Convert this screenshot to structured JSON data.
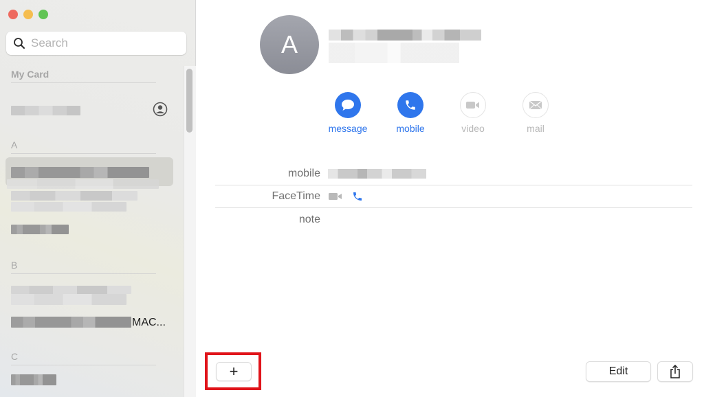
{
  "window": {
    "traffic_lights": [
      "close",
      "minimize",
      "maximize"
    ]
  },
  "sidebar": {
    "search": {
      "placeholder": "Search",
      "value": "",
      "icon": "search-icon"
    },
    "my_card_header": "My Card",
    "my_card_icon": "person-circle-icon",
    "sections": [
      {
        "letter": "A"
      },
      {
        "letter": "B"
      },
      {
        "letter": "C"
      }
    ],
    "visible_truncated_text": "MAC..."
  },
  "contact": {
    "avatar_initial": "A",
    "actions": [
      {
        "label": "message",
        "icon": "message-bubble-icon",
        "enabled": true
      },
      {
        "label": "mobile",
        "icon": "phone-icon",
        "enabled": true
      },
      {
        "label": "video",
        "icon": "video-camera-icon",
        "enabled": false
      },
      {
        "label": "mail",
        "icon": "envelope-icon",
        "enabled": false
      }
    ],
    "fields": [
      {
        "label": "mobile"
      },
      {
        "label": "FaceTime"
      },
      {
        "label": "note"
      }
    ]
  },
  "toolbar": {
    "add_label": "+",
    "edit_label": "Edit",
    "share_icon": "share-icon"
  },
  "colors": {
    "accent": "#2f76ec",
    "highlight_box": "#e0141a"
  }
}
